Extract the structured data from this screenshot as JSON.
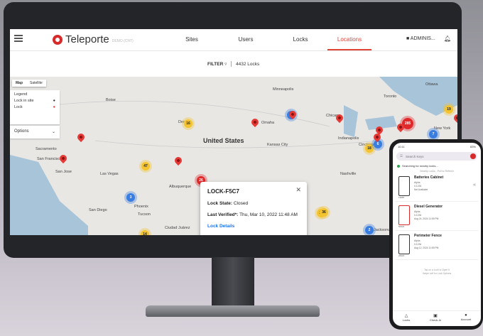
{
  "app": {
    "name": "Teleporte",
    "sub": "DEMO (CNT)"
  },
  "nav": [
    "Sites",
    "Users",
    "Locks",
    "Locations"
  ],
  "active_nav": "Locations",
  "user": "ADMINIS...",
  "filter": {
    "label": "FILTER",
    "count": "4432 Locks"
  },
  "map": {
    "types": [
      "Map",
      "Satellite"
    ],
    "legend": {
      "title": "Legend",
      "items": [
        "Lock in site",
        "Lock"
      ]
    },
    "options": "Options",
    "country": "United States",
    "cities": [
      "Boise",
      "Omaha",
      "Minneapolis",
      "Toronto",
      "Ottawa",
      "Chicago",
      "Denver",
      "Kansas City",
      "Indianapolis",
      "Cincinnati",
      "New York",
      "Sacramento",
      "San Francisco",
      "San Jose",
      "Las Vegas",
      "Albuquerque",
      "Phoenix",
      "Tucson",
      "San Diego",
      "Ciudad Juárez",
      "Nashville",
      "Jacksonville"
    ],
    "clusters": [
      "16",
      "6",
      "19",
      "285",
      "18",
      "7",
      "47",
      "26",
      "3",
      "20",
      "14",
      "92",
      "27",
      "23",
      "7",
      "36",
      "16",
      "2",
      "6"
    ]
  },
  "popup": {
    "title": "LOCK-F5C7",
    "state_label": "Lock State:",
    "state_value": "Closed",
    "verified_label": "Last Verified*:",
    "verified_value": "Thu, Mar 10, 2022 11:48 AM",
    "link": "Lock Details"
  },
  "phone": {
    "time": "10:11",
    "battery": "83%",
    "search_placeholder": "Search Keys",
    "scanning": "Searching for nearby locks...",
    "nearby": "Nearby Locks - Pull to Refresh",
    "cards": [
      {
        "name": "Batteries Cabinet",
        "code": "11188",
        "meta1": "Alpha",
        "meta2": "0-1234",
        "meta3": "Not Available"
      },
      {
        "name": "Diesel Generator",
        "code": "54321",
        "meta1": "Alpha",
        "meta2": "0-1234",
        "meta3": "Aug 24, 2024 11:59 PM"
      },
      {
        "name": "Perimeter Fence",
        "code": "24915",
        "meta1": "Alpha",
        "meta2": "0-1234",
        "meta3": "Aug 12, 2024 11:59 PM"
      }
    ],
    "hint1": "Tap on a Lock to Open it",
    "hint2": "Swipe Left for Lock Options",
    "tabs": [
      "Locks",
      "Check-In",
      "Account"
    ]
  }
}
